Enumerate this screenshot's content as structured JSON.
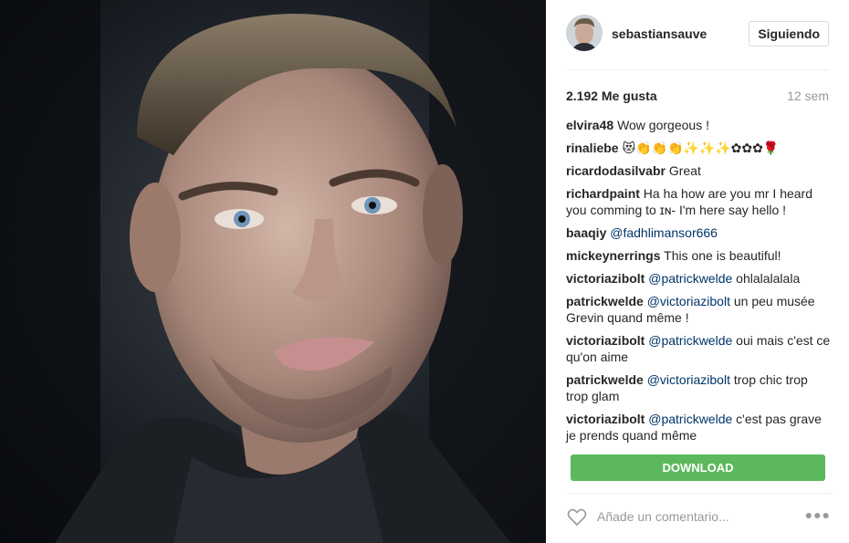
{
  "post": {
    "username": "sebastiansauve",
    "follow_label": "Siguiendo",
    "likes": "2.192 Me gusta",
    "time": "12 sem"
  },
  "comments": [
    {
      "user": "elvira48",
      "mention": "",
      "text": "Wow gorgeous !"
    },
    {
      "user": "rinaliebe",
      "mention": "",
      "text": "😻👏👏👏✨✨✨✿✿✿🌹"
    },
    {
      "user": "ricardodasilvabr",
      "mention": "",
      "text": "Great"
    },
    {
      "user": "richardpaint",
      "mention": "",
      "text": "Ha ha how are you mr I heard you comming to ɪɴ- I'm here say hello !"
    },
    {
      "user": "baaqiy",
      "mention": "@fadhlimansor666",
      "text": ""
    },
    {
      "user": "mickeynerrings",
      "mention": "",
      "text": "This one is beautiful!"
    },
    {
      "user": "victoriazibolt",
      "mention": "@patrickwelde",
      "text": "ohlalalalala"
    },
    {
      "user": "patrickwelde",
      "mention": "@victoriazibolt",
      "text": "un peu musée Grevin quand même !"
    },
    {
      "user": "victoriazibolt",
      "mention": "@patrickwelde",
      "text": "oui mais c'est ce qu'on aime"
    },
    {
      "user": "patrickwelde",
      "mention": "@victoriazibolt",
      "text": "trop chic trop trop glam"
    },
    {
      "user": "victoriazibolt",
      "mention": "@patrickwelde",
      "text": "c'est pas grave je prends quand même"
    }
  ],
  "download_label": "DOWNLOAD",
  "footer": {
    "add_comment_placeholder": "Añade un comentario...",
    "more_icon": "more-icon",
    "heart_icon": "heart-icon"
  },
  "colors": {
    "download_green": "#5cb85c",
    "mention_blue": "#003569",
    "muted_gray": "#999999"
  }
}
